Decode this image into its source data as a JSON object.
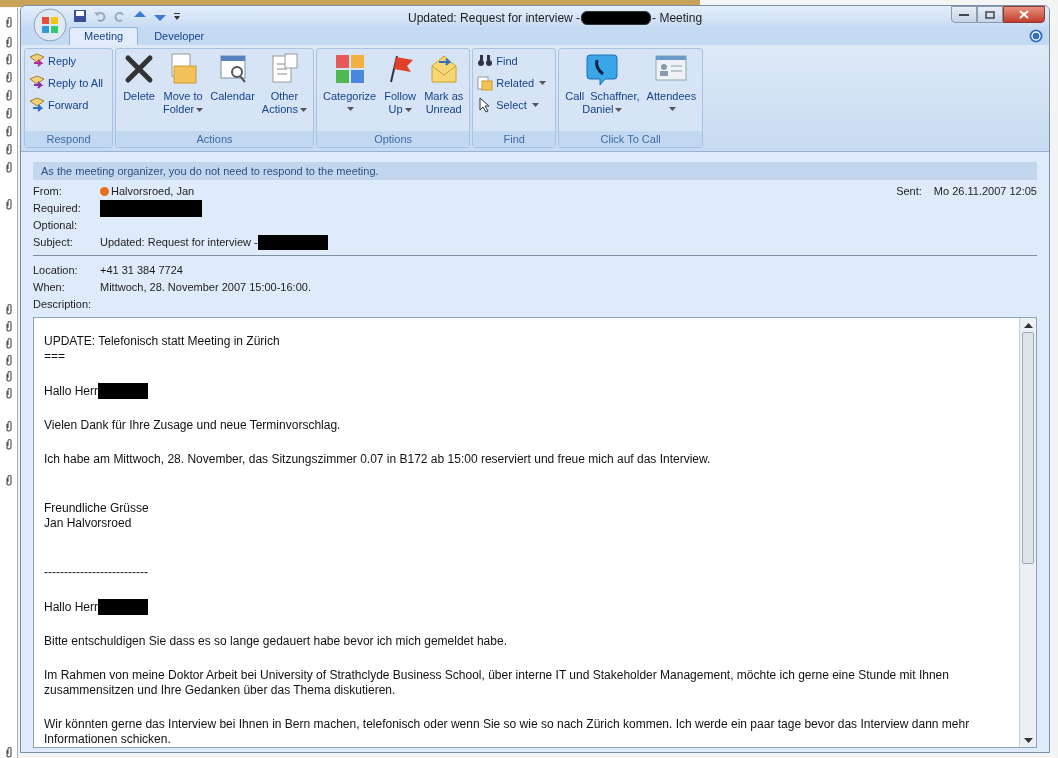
{
  "window": {
    "title_before": "Updated: Request for interview -",
    "title_after": "- Meeting"
  },
  "tabs": [
    {
      "label": "Meeting",
      "selected": true
    },
    {
      "label": "Developer",
      "selected": false
    }
  ],
  "ribbon_groups": [
    {
      "label": "Respond",
      "buttons": [
        {
          "kind": "small",
          "lines": [
            "Reply"
          ],
          "dropdown": false
        },
        {
          "kind": "small",
          "lines": [
            "Reply to All"
          ],
          "dropdown": false
        },
        {
          "kind": "small",
          "lines": [
            "Forward"
          ],
          "dropdown": false
        }
      ]
    },
    {
      "label": "Actions",
      "buttons": [
        {
          "kind": "large",
          "lines": [
            "Delete"
          ],
          "dropdown": false
        },
        {
          "kind": "large",
          "lines": [
            "Move to",
            "Folder"
          ],
          "dropdown": true
        },
        {
          "kind": "large",
          "lines": [
            "Calendar"
          ],
          "dropdown": false
        },
        {
          "kind": "large",
          "lines": [
            "Other",
            "Actions"
          ],
          "dropdown": true
        }
      ]
    },
    {
      "label": "Options",
      "buttons": [
        {
          "kind": "large",
          "lines": [
            "Categorize"
          ],
          "dropdown": true
        },
        {
          "kind": "large",
          "lines": [
            "Follow",
            "Up"
          ],
          "dropdown": true
        },
        {
          "kind": "large",
          "lines": [
            "Mark as",
            "Unread"
          ],
          "dropdown": false
        }
      ]
    },
    {
      "label": "Find",
      "buttons": [
        {
          "kind": "small",
          "lines": [
            "Find"
          ],
          "dropdown": false
        },
        {
          "kind": "small",
          "lines": [
            "Related"
          ],
          "dropdown": true
        },
        {
          "kind": "small",
          "lines": [
            "Select"
          ],
          "dropdown": true
        }
      ]
    },
    {
      "label": "Click To Call",
      "buttons": [
        {
          "kind": "large",
          "lines": [
            "Call  Schaffner,",
            "Daniel"
          ],
          "dropdown": true
        },
        {
          "kind": "large",
          "lines": [
            "Attendees"
          ],
          "dropdown": true
        }
      ]
    }
  ],
  "info_bar": "As the meeting organizer, you do not need to respond to the meeting.",
  "header": {
    "from_label": "From:",
    "from": {
      "name": "Halvorsroed, Jan",
      "color": "#e8701a"
    },
    "required_label": "Required:",
    "optional_label": "Optional:",
    "subject_label": "Subject:",
    "subject": "Updated: Request for interview -",
    "sent_label": "Sent:",
    "sent": "Mo 26.11.2007 12:05"
  },
  "details": [
    {
      "label": "Location:",
      "value": "+41 31 384 7724"
    },
    {
      "label": "When:",
      "value": "Mittwoch, 28. November 2007 15:00-16:00."
    },
    {
      "label": "Description:"
    }
  ],
  "body": [
    {
      "kind": "lines",
      "lines": [
        "UPDATE: Telefonisch statt Meeting in Zürich",
        "==="
      ]
    },
    {
      "kind": "greeting",
      "text": "Hallo Herr"
    },
    {
      "kind": "lines",
      "lines": [
        "Vielen Dank für Ihre Zusage und neue Terminvorschlag."
      ]
    },
    {
      "kind": "lines",
      "lines": [
        "Ich habe am Mittwoch, 28. November, das Sitzungszimmer 0.07 in B172 ab 15:00 reserviert und freue mich auf das Interview."
      ]
    },
    {
      "kind": "spacer"
    },
    {
      "kind": "lines",
      "lines": [
        "Freundliche Grüsse",
        "Jan Halvorsroed"
      ]
    },
    {
      "kind": "spacer"
    },
    {
      "kind": "lines",
      "lines": [
        "--------------------------"
      ]
    },
    {
      "kind": "greeting",
      "text": "Hallo Herr"
    },
    {
      "kind": "lines",
      "lines": [
        "Bitte entschuldigen Sie dass es so lange gedauert habe bevor ich mich gemeldet habe."
      ]
    },
    {
      "kind": "paragraph",
      "text": "Im Rahmen von meine Doktor Arbeit bei University of Strathclyde Business School, über interne IT und Stakeholder Management, möchte ich gerne eine Stunde mit Ihnen zusammensitzen und Ihre Gedanken über das Thema diskutieren."
    },
    {
      "kind": "paragraph",
      "text": "Wir könnten gerne das Interview bei Ihnen in Bern machen,  telefonisch oder wenn Sie so wie so nach Zürich kommen. Ich werde ein paar tage bevor das Interview dann mehr Informationen schicken."
    }
  ]
}
